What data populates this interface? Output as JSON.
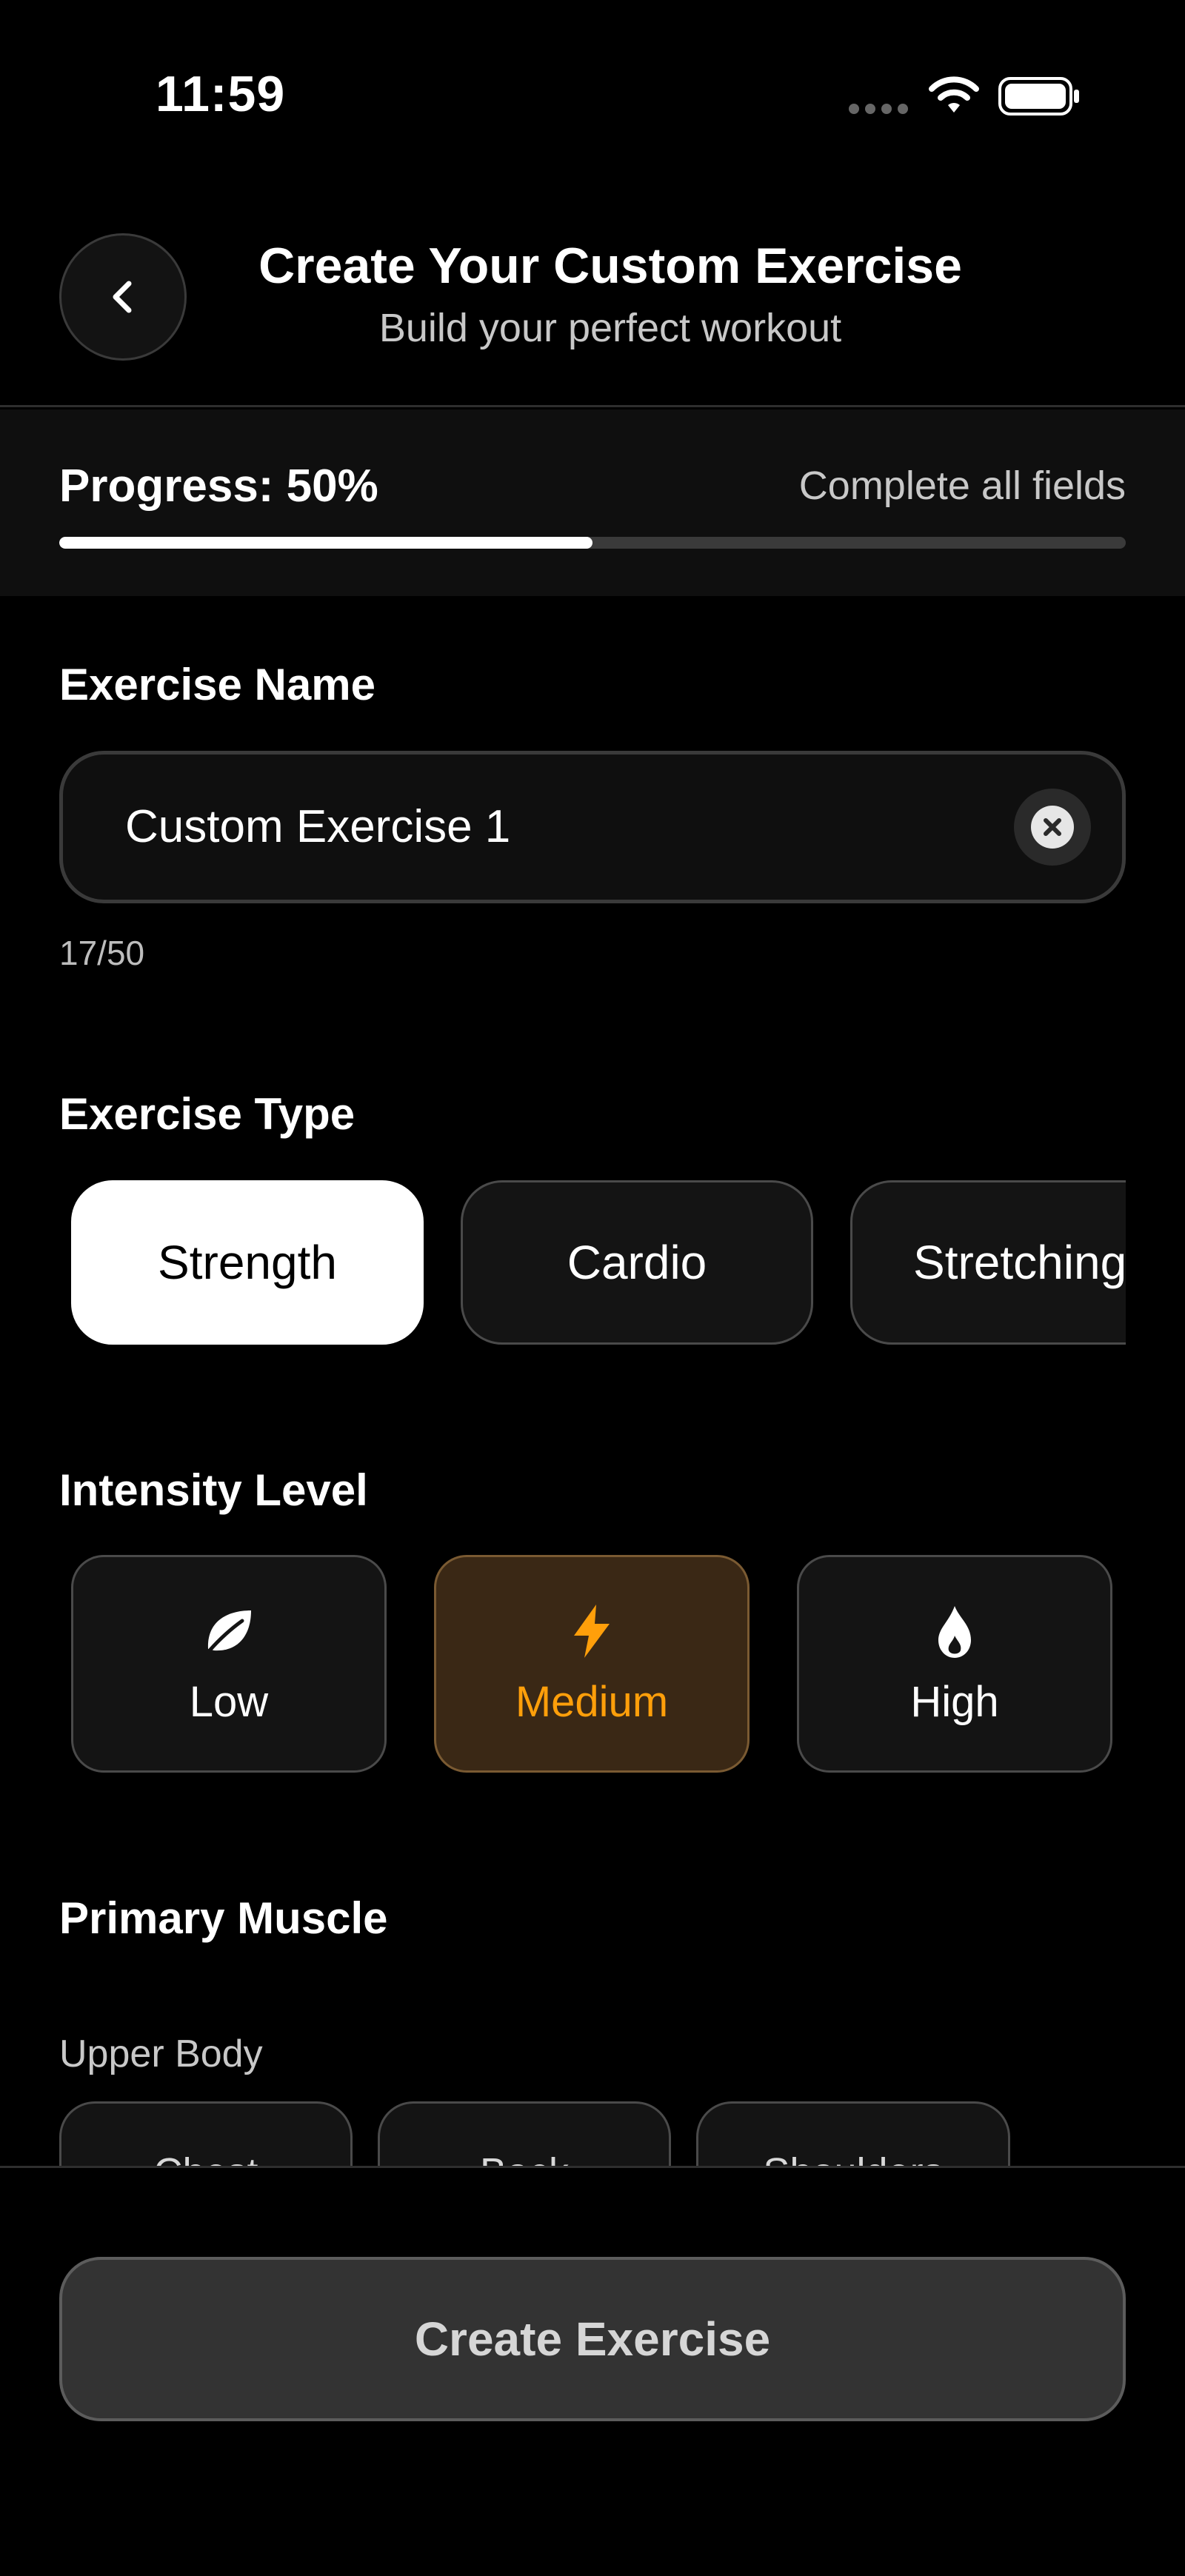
{
  "status_bar": {
    "time": "11:59"
  },
  "header": {
    "title": "Create Your Custom Exercise",
    "subtitle": "Build your perfect workout"
  },
  "progress": {
    "label": "Progress: 50%",
    "hint": "Complete all fields",
    "value_percent": 50
  },
  "exercise_name": {
    "label": "Exercise Name",
    "value": "Custom Exercise 1",
    "char_count": "17/50"
  },
  "exercise_type": {
    "label": "Exercise Type",
    "options": [
      {
        "label": "Strength",
        "selected": true
      },
      {
        "label": "Cardio",
        "selected": false
      },
      {
        "label": "Stretching",
        "selected": false
      }
    ]
  },
  "intensity": {
    "label": "Intensity Level",
    "options": [
      {
        "label": "Low",
        "icon": "leaf-icon",
        "selected": false
      },
      {
        "label": "Medium",
        "icon": "lightning-icon",
        "selected": true
      },
      {
        "label": "High",
        "icon": "flame-icon",
        "selected": false
      }
    ],
    "accent_color": "#ff9f0a"
  },
  "primary_muscle": {
    "label": "Primary Muscle",
    "group_label": "Upper Body",
    "chips": [
      "Chest",
      "Back",
      "Shoulders"
    ]
  },
  "actions": {
    "create_label": "Create Exercise"
  }
}
